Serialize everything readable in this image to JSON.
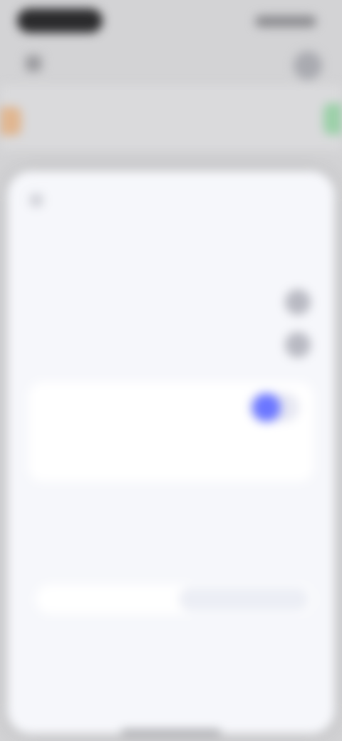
{
  "status_bar": {
    "time": "",
    "indicators": ""
  },
  "app_bar": {
    "title": ""
  },
  "sheet": {
    "title": "",
    "section_label": "",
    "row1_label": "",
    "row2_label": "",
    "card": {
      "title": "",
      "description": "",
      "toggle_state": "on",
      "accent_color": "#6b76ff"
    },
    "subsection": {
      "title": "",
      "label": "",
      "segments": [
        "",
        ""
      ],
      "selected_index": 1
    },
    "danger_action": "",
    "danger_color": "#e15a6a"
  }
}
